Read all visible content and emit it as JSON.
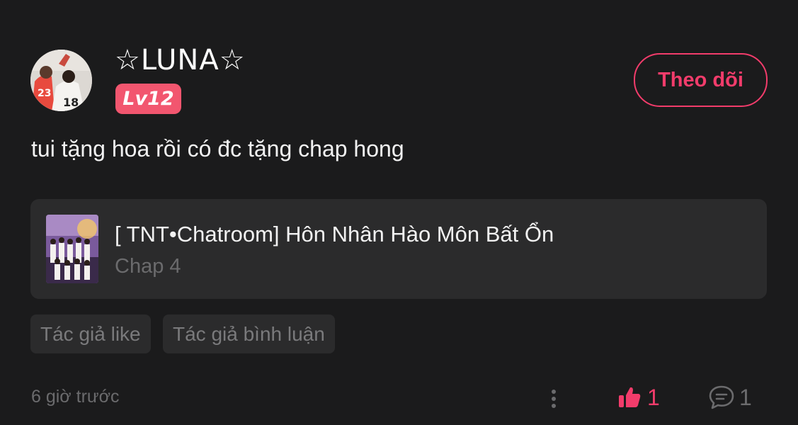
{
  "post": {
    "username": "☆LUNA☆",
    "level": "Lv12",
    "follow_label": "Theo dõi",
    "comment": "tui tặng hoa rồi có đc tặng chap hong",
    "work": {
      "title": "[ TNT•Chatroom] Hôn Nhân Hào Môn Bất Ổn",
      "chapter": "Chap 4"
    },
    "tags": [
      "Tác giả like",
      "Tác giả bình luận"
    ],
    "timestamp": "6 giờ trước",
    "like_count": "1",
    "comment_count": "1"
  },
  "colors": {
    "background": "#1b1b1c",
    "accent": "#f23c6b",
    "badge": "#f2566f",
    "card": "#2b2b2c",
    "muted_text": "#6b6b6d"
  },
  "icons": {
    "more": "vertical-dots-icon",
    "like": "thumbs-up-icon",
    "comment": "speech-bubble-icon"
  }
}
